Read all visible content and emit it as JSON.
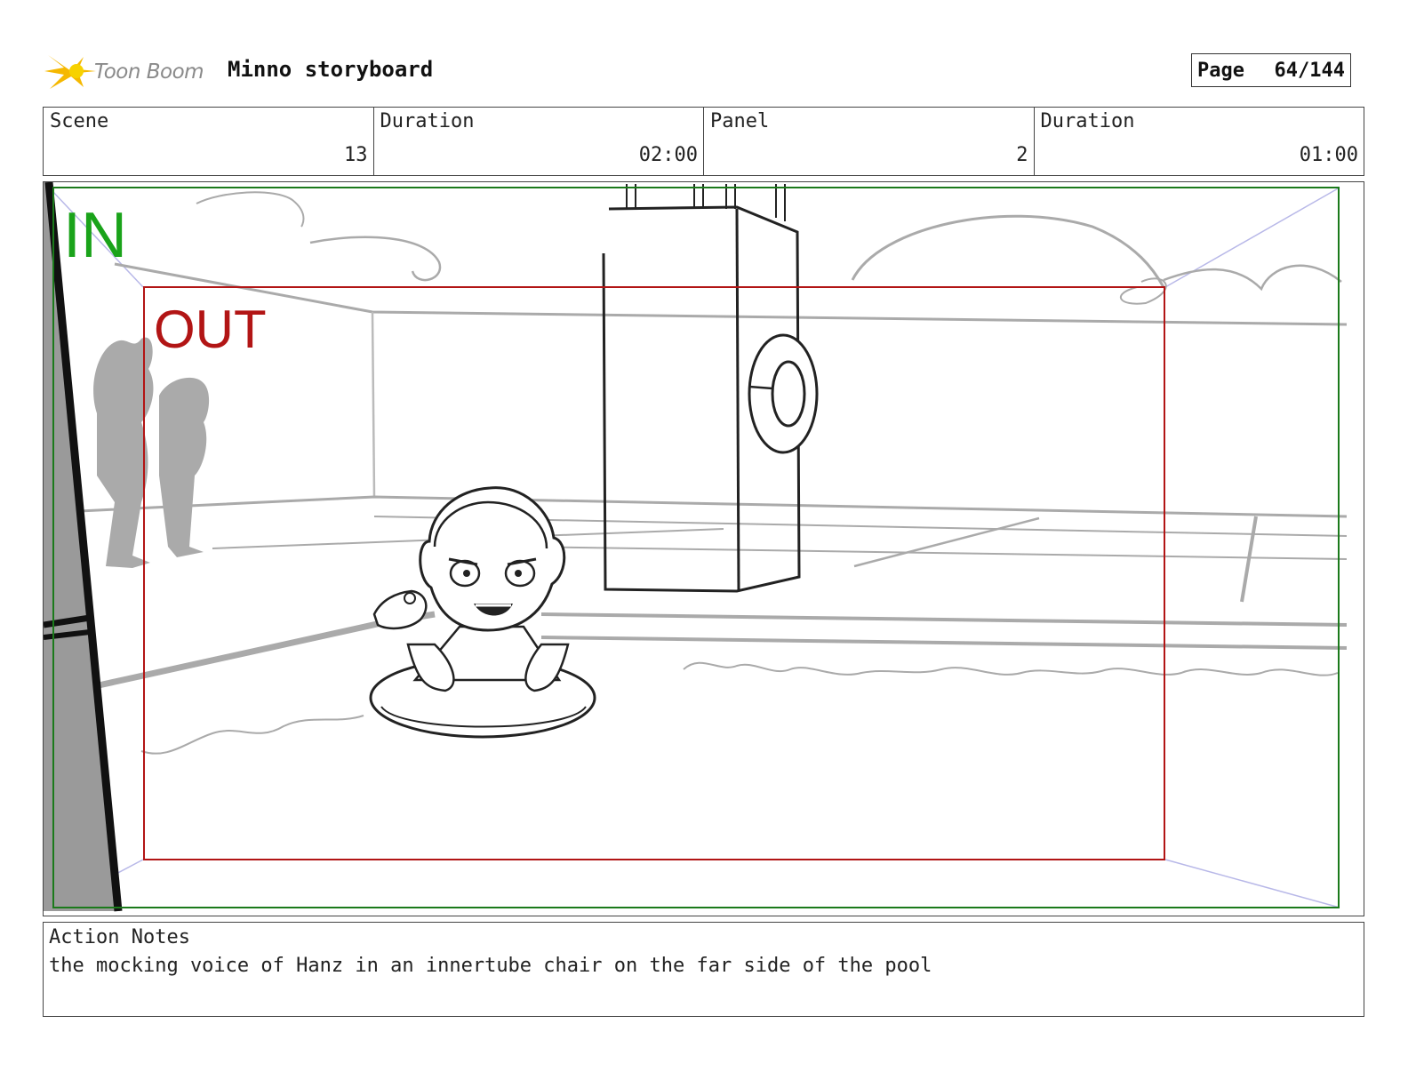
{
  "header": {
    "brand": "Toon Boom",
    "project_title": "Minno storyboard",
    "page_label": "Page",
    "page_value": "64/144"
  },
  "info": {
    "scene_label": "Scene",
    "scene_value": "13",
    "scene_duration_label": "Duration",
    "scene_duration_value": "02:00",
    "panel_label": "Panel",
    "panel_value": "2",
    "panel_duration_label": "Duration",
    "panel_duration_value": "01:00"
  },
  "frame": {
    "in_label": "IN",
    "out_label": "OUT",
    "in_color": "#1aa31a",
    "out_color": "#b21515"
  },
  "notes": {
    "label": "Action Notes",
    "text": "the mocking voice of Hanz in an innertube chair on the far side of the pool"
  }
}
